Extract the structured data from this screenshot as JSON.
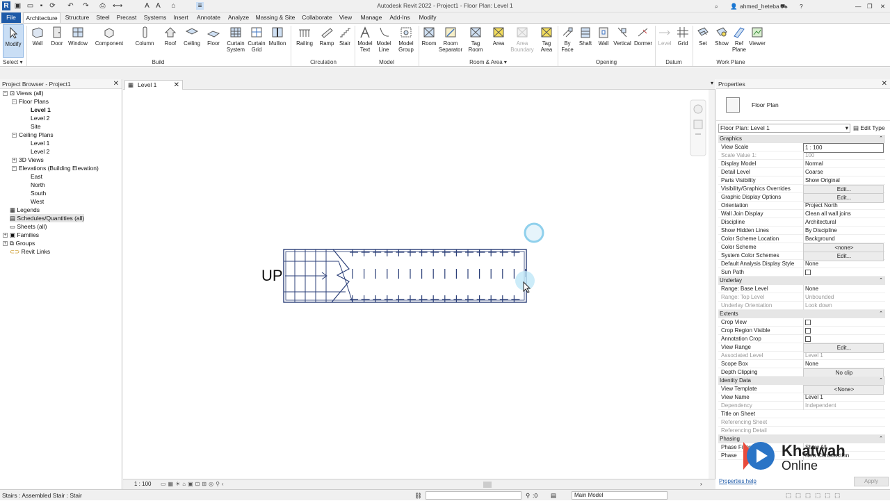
{
  "title": "Autodesk Revit 2022 - Project1 - Floor Plan: Level 1",
  "user": {
    "name": "ahmed_heteba"
  },
  "tabs": [
    "File",
    "Architecture",
    "Structure",
    "Steel",
    "Precast",
    "Systems",
    "Insert",
    "Annotate",
    "Analyze",
    "Massing & Site",
    "Collaborate",
    "View",
    "Manage",
    "Add-Ins",
    "Modify"
  ],
  "ribbon": {
    "modify": "Modify",
    "select": "Select",
    "build": {
      "label": "Build",
      "items": [
        "Wall",
        "Door",
        "Window",
        "Component",
        "Column",
        "Roof",
        "Ceiling",
        "Floor",
        "Curtain System",
        "Curtain Grid",
        "Mullion"
      ]
    },
    "circulation": {
      "label": "Circulation",
      "items": [
        "Railing",
        "Ramp",
        "Stair"
      ]
    },
    "model": {
      "label": "Model",
      "items": [
        "Model Text",
        "Model Line",
        "Model Group"
      ]
    },
    "room_area": {
      "label": "Room & Area",
      "items": [
        "Room",
        "Room Separator",
        "Tag Room",
        "Area",
        "Area Boundary",
        "Tag Area"
      ]
    },
    "opening": {
      "label": "Opening",
      "items": [
        "By Face",
        "Shaft",
        "Wall",
        "Vertical",
        "Dormer"
      ]
    },
    "datum": {
      "label": "Datum",
      "items": [
        "Level",
        "Grid"
      ]
    },
    "work_plane": {
      "label": "Work Plane",
      "items": [
        "Set",
        "Show",
        "Ref Plane",
        "Viewer"
      ]
    }
  },
  "project_browser": {
    "title": "Project Browser - Project1",
    "items": [
      "Views (all)",
      "Floor Plans",
      "Level 1",
      "Level 2",
      "Site",
      "Ceiling Plans",
      "Level 1",
      "Level 2",
      "3D Views",
      "Elevations (Building Elevation)",
      "East",
      "North",
      "South",
      "West",
      "Legends",
      "Schedules/Quantities (all)",
      "Sheets (all)",
      "Families",
      "Groups",
      "Revit Links"
    ]
  },
  "view": {
    "tab": "Level 1",
    "scale": "1 : 100",
    "stair_label": "UP"
  },
  "properties": {
    "title": "Properties",
    "type": "Floor Plan",
    "selector": "Floor Plan: Level 1",
    "edit_type": "Edit Type",
    "groups": {
      "graphics": "Graphics",
      "underlay": "Underlay",
      "extents": "Extents",
      "identity": "Identity Data",
      "phasing": "Phasing"
    },
    "rows": [
      [
        "View Scale",
        "1 : 100"
      ],
      [
        "Scale Value    1:",
        "100"
      ],
      [
        "Display Model",
        "Normal"
      ],
      [
        "Detail Level",
        "Coarse"
      ],
      [
        "Parts Visibility",
        "Show Original"
      ],
      [
        "Visibility/Graphics Overrides",
        "Edit..."
      ],
      [
        "Graphic Display Options",
        "Edit..."
      ],
      [
        "Orientation",
        "Project North"
      ],
      [
        "Wall Join Display",
        "Clean all wall joins"
      ],
      [
        "Discipline",
        "Architectural"
      ],
      [
        "Show Hidden Lines",
        "By Discipline"
      ],
      [
        "Color Scheme Location",
        "Background"
      ],
      [
        "Color Scheme",
        "<none>"
      ],
      [
        "System Color Schemes",
        "Edit..."
      ],
      [
        "Default Analysis Display Style",
        "None"
      ],
      [
        "Sun Path",
        ""
      ],
      [
        "Range: Base Level",
        "None"
      ],
      [
        "Range: Top Level",
        "Unbounded"
      ],
      [
        "Underlay Orientation",
        "Look down"
      ],
      [
        "Crop View",
        ""
      ],
      [
        "Crop Region Visible",
        ""
      ],
      [
        "Annotation Crop",
        ""
      ],
      [
        "View Range",
        "Edit..."
      ],
      [
        "Associated Level",
        "Level 1"
      ],
      [
        "Scope Box",
        "None"
      ],
      [
        "Depth Clipping",
        "No clip"
      ],
      [
        "View Template",
        "<None>"
      ],
      [
        "View Name",
        "Level 1"
      ],
      [
        "Dependency",
        "Independent"
      ],
      [
        "Title on Sheet",
        ""
      ],
      [
        "Referencing Sheet",
        ""
      ],
      [
        "Referencing Detail",
        ""
      ],
      [
        "Phase Filter",
        "Show All"
      ],
      [
        "Phase",
        "New Construction"
      ]
    ],
    "help": "Properties help",
    "apply": "Apply"
  },
  "status": {
    "text": "Stairs : Assembled Stair : Stair",
    "coord": ":0",
    "model": "Main Model"
  },
  "watermark": {
    "line1": "Khatwah",
    "line2": "Online"
  }
}
